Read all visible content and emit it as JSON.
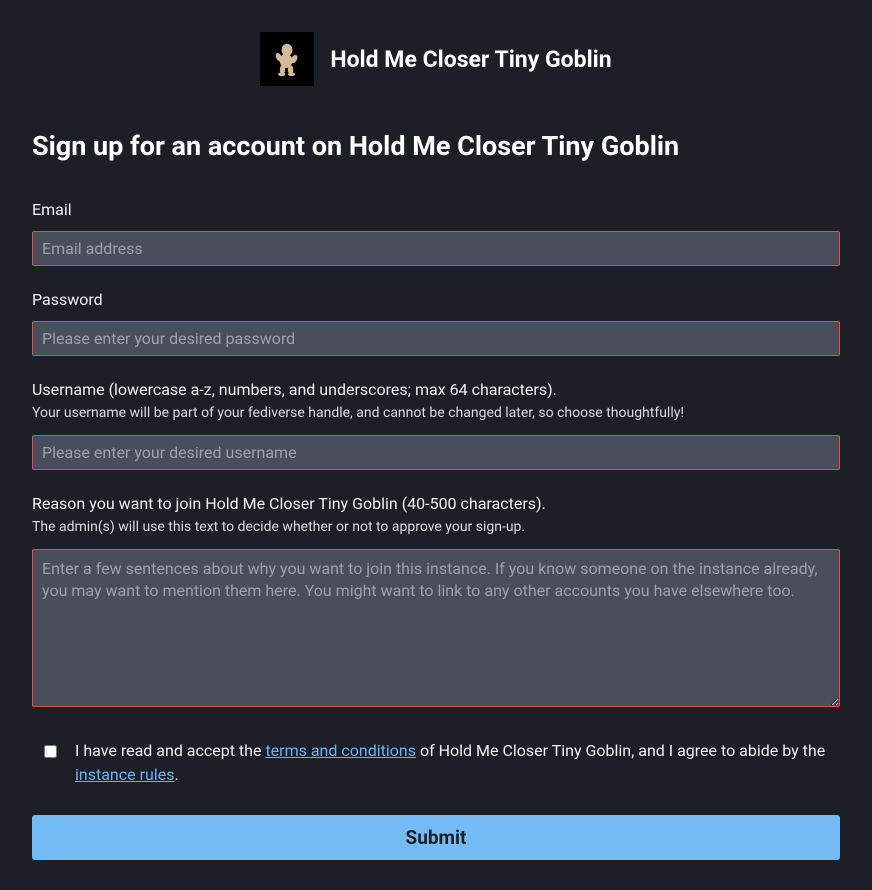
{
  "header": {
    "site_title": "Hold Me Closer Tiny Goblin"
  },
  "page": {
    "heading": "Sign up for an account on Hold Me Closer Tiny Goblin"
  },
  "form": {
    "email": {
      "label": "Email",
      "placeholder": "Email address",
      "value": ""
    },
    "password": {
      "label": "Password",
      "placeholder": "Please enter your desired password",
      "value": ""
    },
    "username": {
      "label": "Username (lowercase a-z, numbers, and underscores; max 64 characters).",
      "help": "Your username will be part of your fediverse handle, and cannot be changed later, so choose thoughtfully!",
      "placeholder": "Please enter your desired username",
      "value": ""
    },
    "reason": {
      "label": "Reason you want to join Hold Me Closer Tiny Goblin (40-500 characters).",
      "help": "The admin(s) will use this text to decide whether or not to approve your sign-up.",
      "placeholder": "Enter a few sentences about why you want to join this instance. If you know someone on the instance already, you may want to mention them here. You might want to link to any other accounts you have elsewhere too.",
      "value": ""
    },
    "agreement": {
      "text_prefix": "I have read and accept the ",
      "terms_link": "terms and conditions",
      "text_middle": " of Hold Me Closer Tiny Goblin, and I agree to abide by the ",
      "rules_link": "instance rules",
      "text_suffix": "."
    },
    "submit": {
      "label": "Submit"
    }
  }
}
